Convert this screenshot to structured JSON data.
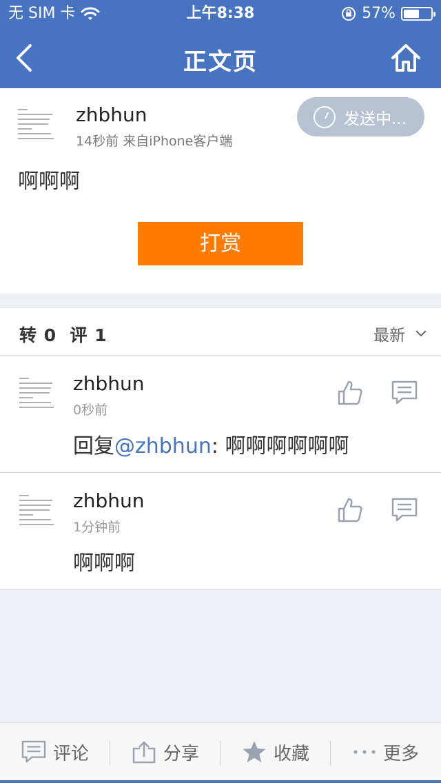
{
  "status_bar": {
    "carrier": "无 SIM 卡",
    "time": "上午8:38",
    "battery": "57%",
    "battery_level": 0.57
  },
  "nav": {
    "title": "正文页",
    "back_icon": "chevron-left-icon",
    "home_icon": "home-icon"
  },
  "post": {
    "author": "zhbhun",
    "meta": "14秒前  来自iPhone客户端",
    "status_label": "发送中...",
    "content": "啊啊啊",
    "reward_label": "打赏"
  },
  "stats": {
    "summary": "转 0  评 1",
    "sort_label": "最新"
  },
  "comments": [
    {
      "author": "zhbhun",
      "time": "0秒前",
      "reply_prefix": "回复",
      "mention": "@zhbhun",
      "content": ": 啊啊啊啊啊啊"
    },
    {
      "author": "zhbhun",
      "time": "1分钟前",
      "content": "啊啊啊"
    }
  ],
  "toolbar": {
    "comment": "评论",
    "share": "分享",
    "favorite": "收藏",
    "more": "更多"
  },
  "colors": {
    "brand": "#4773c0",
    "reward": "#ff7c00",
    "sending_badge": "#b9c2d3"
  }
}
